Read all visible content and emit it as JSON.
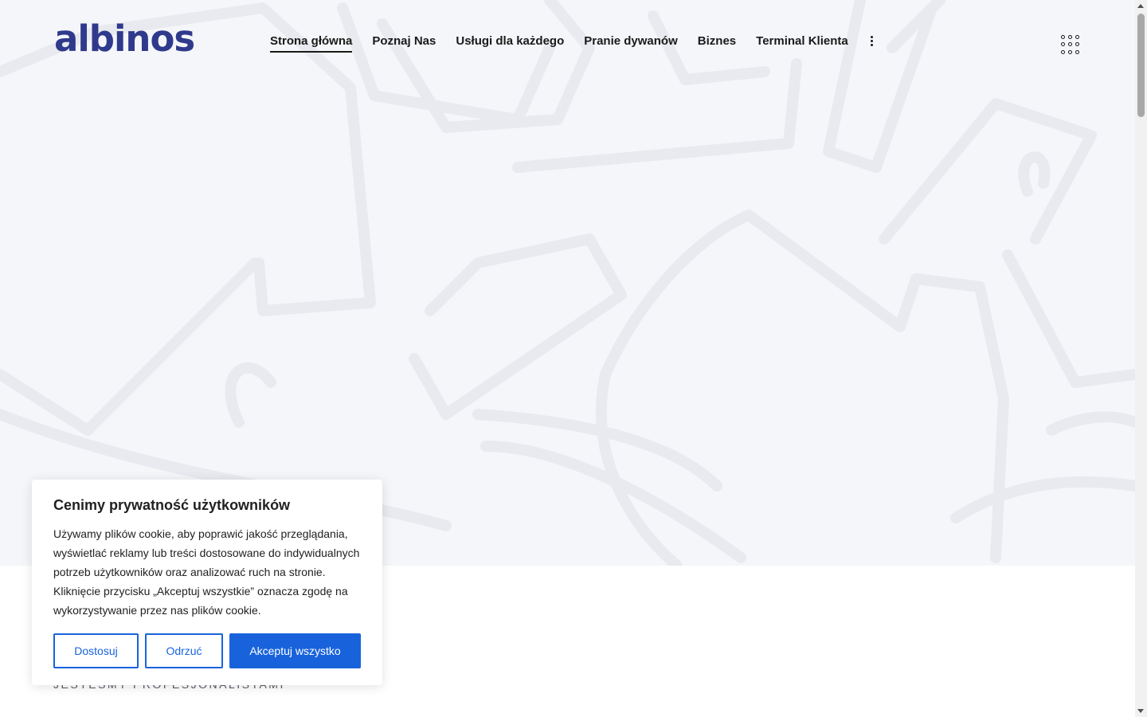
{
  "header": {
    "logo_text": "albinos",
    "nav": [
      {
        "label": "Strona główna",
        "active": true
      },
      {
        "label": "Poznaj Nas",
        "active": false
      },
      {
        "label": "Usługi dla każdego",
        "active": false
      },
      {
        "label": "Pranie dywanów",
        "active": false
      },
      {
        "label": "Biznes",
        "active": false
      },
      {
        "label": "Terminal Klienta",
        "active": false
      }
    ],
    "more_icon": "vertical-dots-icon",
    "menu_icon": "grid-dots-icon"
  },
  "section": {
    "eyebrow": "JESTEŚMY PROFESJONALISTAMI"
  },
  "cookie_banner": {
    "title": "Cenimy prywatność użytkowników",
    "text": "Używamy plików cookie, aby poprawić jakość przeglądania, wyświetlać reklamy lub treści dostosowane do indywidualnych potrzeb użytkowników oraz analizować ruch na stronie. Kliknięcie przycisku „Akceptuj wszystkie” oznacza zgodę na wykorzystywanie przez nas plików cookie.",
    "customize_label": "Dostosuj",
    "reject_label": "Odrzuć",
    "accept_label": "Akceptuj wszystko"
  },
  "colors": {
    "brand": "#2f3a8c",
    "accent": "#1863dc",
    "hero_bg": "#f5f6f9"
  }
}
